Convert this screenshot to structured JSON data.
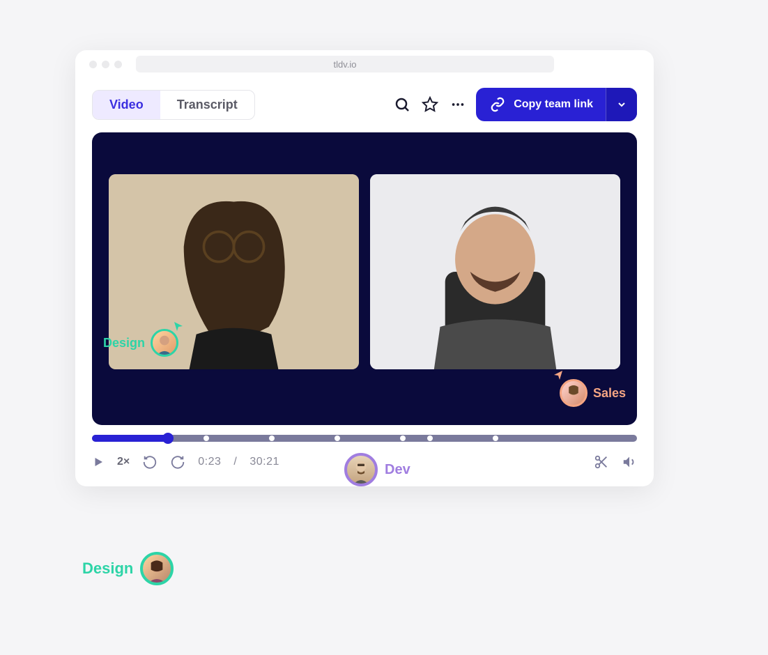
{
  "browser": {
    "url": "tldv.io"
  },
  "tabs": {
    "video": "Video",
    "transcript": "Transcript"
  },
  "toolbar": {
    "copy_link": "Copy team link"
  },
  "badges": {
    "design": "Design",
    "sales": "Sales",
    "dev": "Dev"
  },
  "player": {
    "speed": "2×",
    "current_time": "0:23",
    "separator": "/",
    "total_time": "30:21",
    "progress_pct": 14,
    "markers_pct": [
      21,
      33,
      45,
      57,
      62,
      74
    ]
  },
  "colors": {
    "primary": "#2921d4",
    "design": "#2dd4a7",
    "sales": "#f4a583",
    "dev": "#a07de0",
    "video_bg": "#0a0a3c"
  }
}
